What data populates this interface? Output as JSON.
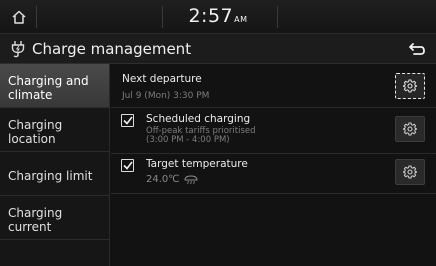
{
  "status_bar": {
    "time": "2:57",
    "ampm": "AM"
  },
  "title_bar": {
    "title": "Charge management"
  },
  "sidebar": {
    "items": [
      {
        "label": "Charging and climate",
        "active": true
      },
      {
        "label": "Charging location",
        "active": false
      },
      {
        "label": "Charging limit",
        "active": false
      },
      {
        "label": "Charging current",
        "active": false
      }
    ]
  },
  "content": {
    "next_departure": {
      "title": "Next departure",
      "value": "Jul 9 (Mon) 3:30 PM"
    },
    "scheduled_charging": {
      "title": "Scheduled charging",
      "checked": true,
      "line1": "Off-peak tariffs prioritised",
      "line2": "(3:00 PM - 4:00 PM)"
    },
    "target_temperature": {
      "title": "Target temperature",
      "checked": true,
      "value": "24.0℃"
    }
  },
  "icons": {
    "home": "home-icon",
    "charge": "ev-plug-icon",
    "back": "back-arrow-icon",
    "gear": "gear-icon",
    "check": "check-icon",
    "defrost": "defrost-icon"
  }
}
